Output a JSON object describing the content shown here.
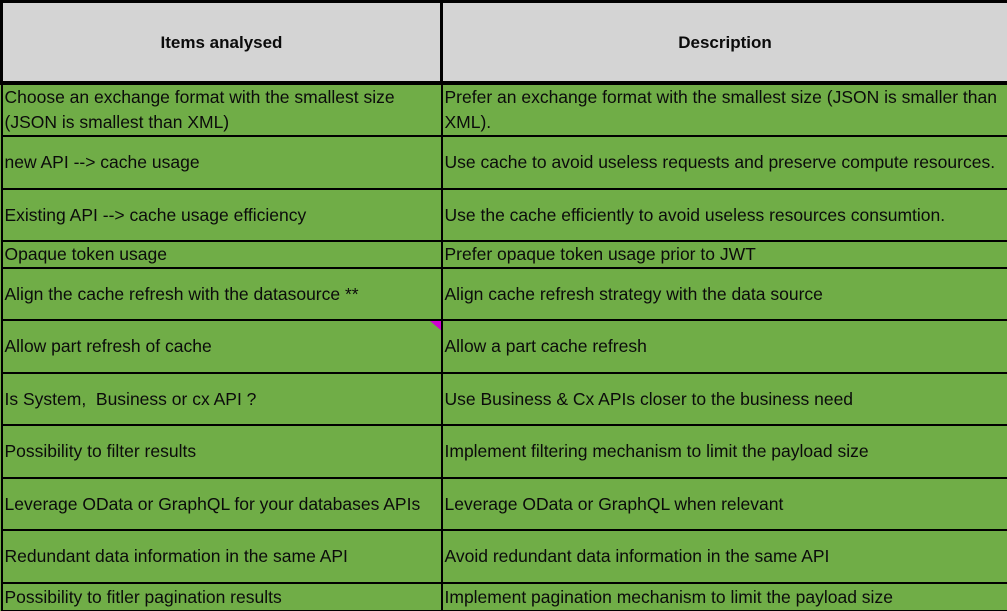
{
  "table": {
    "headers": {
      "items": "Items analysed",
      "description": "Description"
    },
    "rows": [
      {
        "item": "Choose an exchange format with the smallest size (JSON is smallest than XML)",
        "description": "Prefer an exchange format with the smallest size (JSON is smaller than XML)."
      },
      {
        "item": "new API --> cache usage",
        "description": "Use cache to avoid useless requests and preserve compute resources."
      },
      {
        "item": "Existing API --> cache usage efficiency",
        "description": "Use the cache efficiently to avoid useless resources consumtion."
      },
      {
        "item": "Opaque token usage",
        "description": "Prefer opaque token usage prior to JWT"
      },
      {
        "item": "Align the cache refresh with the datasource **",
        "description": "Align cache refresh strategy with the data source"
      },
      {
        "item": "Allow part refresh of cache",
        "description": "Allow a part cache refresh"
      },
      {
        "item": "Is System,  Business or cx API ?",
        "description": "Use Business & Cx APIs closer to the business need"
      },
      {
        "item": "Possibility to filter results",
        "description": "Implement filtering mechanism to limit the payload size"
      },
      {
        "item": "Leverage OData or GraphQL for your databases APIs",
        "description": "Leverage OData or GraphQL when relevant"
      },
      {
        "item": "Redundant data information in the same API",
        "description": "Avoid redundant data information in the same API"
      },
      {
        "item": "Possibility to fitler pagination results",
        "description": "Implement pagination mechanism to limit the payload size"
      }
    ]
  },
  "colors": {
    "header_background": "#d4d4d4",
    "row_background": "#70ad47",
    "grid_lines": "#000000",
    "comment_marker": "#d000d0"
  }
}
